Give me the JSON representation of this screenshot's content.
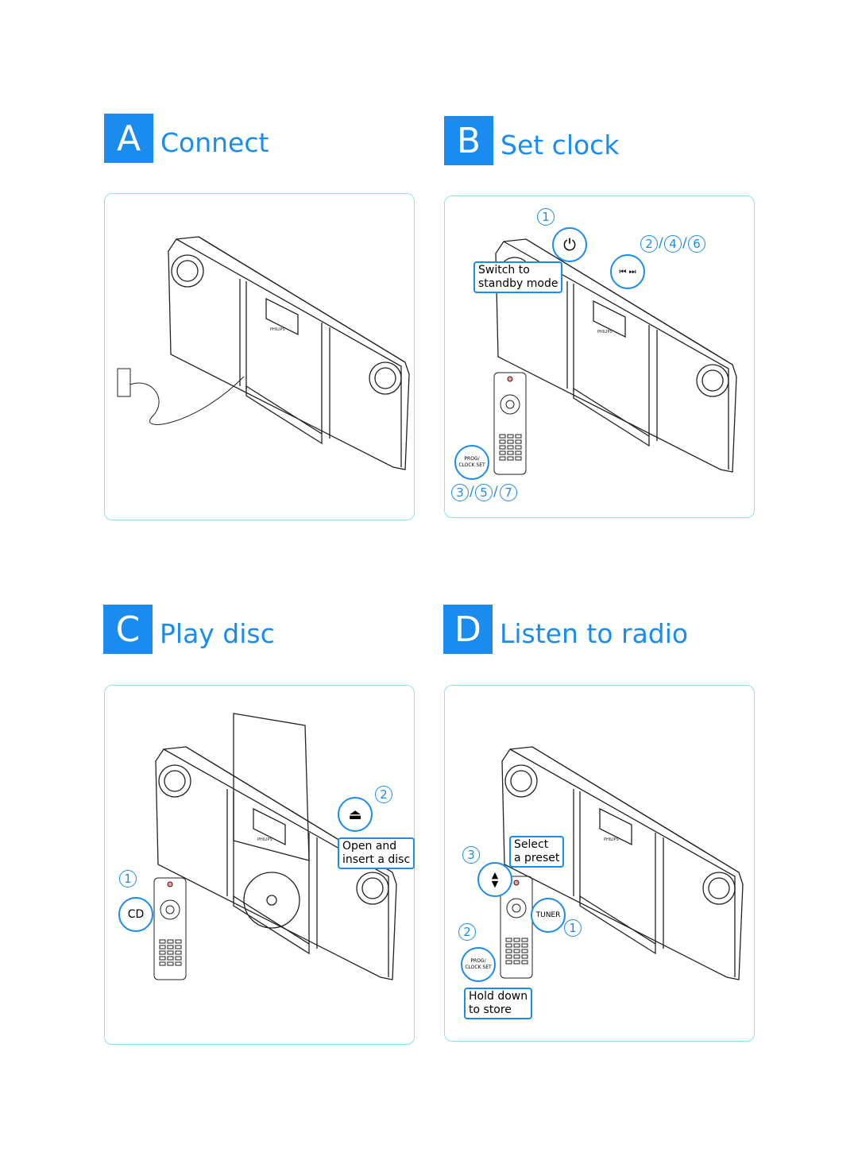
{
  "colors": {
    "accent": "#1a8cf0",
    "panel_border": "#8fe0f2"
  },
  "sections": [
    {
      "letter": "A",
      "title": "Connect"
    },
    {
      "letter": "B",
      "title": "Set clock"
    },
    {
      "letter": "C",
      "title": "Play disc"
    },
    {
      "letter": "D",
      "title": "Listen to radio"
    }
  ],
  "set_clock": {
    "step1": "1",
    "steps_246": [
      "2",
      "4",
      "6"
    ],
    "steps_357": [
      "3",
      "5",
      "7"
    ],
    "power_icon": "power-icon",
    "skip_icon": "⏮ ⏭",
    "standby_label": "Switch to\nstandby mode",
    "prog_label": "PROG/\nCLOCK SET"
  },
  "play_disc": {
    "step1": "1",
    "step2": "2",
    "cd_label": "CD",
    "eject_icon": "⏏",
    "open_label": "Open and\ninsert a disc"
  },
  "radio": {
    "step1": "1",
    "step2": "2",
    "step3": "3",
    "updown_icon": "▲\n▼",
    "tuner_label": "TUNER",
    "prog_label": "PROG/\nCLOCK SET",
    "preset_label": "Select\na preset",
    "store_label": "Hold down\nto store"
  }
}
